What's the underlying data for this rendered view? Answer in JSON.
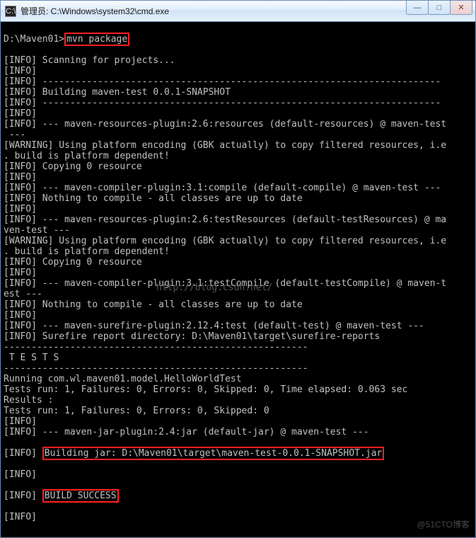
{
  "window": {
    "title": "管理员: C:\\Windows\\system32\\cmd.exe",
    "icon_label": "C:\\"
  },
  "controls": {
    "min": "—",
    "max": "□",
    "close": "✕"
  },
  "prompt": {
    "path": "D:\\Maven01>",
    "command": "mvn package"
  },
  "lines": [
    "[INFO] Scanning for projects...",
    "[INFO]",
    "[INFO] ------------------------------------------------------------------------",
    "[INFO] Building maven-test 0.0.1-SNAPSHOT",
    "[INFO] ------------------------------------------------------------------------",
    "[INFO]",
    "[INFO] --- maven-resources-plugin:2.6:resources (default-resources) @ maven-test",
    " ---",
    "[WARNING] Using platform encoding (GBK actually) to copy filtered resources, i.e",
    ". build is platform dependent!",
    "[INFO] Copying 0 resource",
    "[INFO]",
    "[INFO] --- maven-compiler-plugin:3.1:compile (default-compile) @ maven-test ---",
    "[INFO] Nothing to compile - all classes are up to date",
    "[INFO]",
    "[INFO] --- maven-resources-plugin:2.6:testResources (default-testResources) @ ma",
    "ven-test ---",
    "[WARNING] Using platform encoding (GBK actually) to copy filtered resources, i.e",
    ". build is platform dependent!",
    "[INFO] Copying 0 resource",
    "[INFO]",
    "[INFO] --- maven-compiler-plugin:3.1:testCompile (default-testCompile) @ maven-t",
    "est ---",
    "[INFO] Nothing to compile - all classes are up to date",
    "[INFO]",
    "[INFO] --- maven-surefire-plugin:2.12.4:test (default-test) @ maven-test ---",
    "[INFO] Surefire report directory: D:\\Maven01\\target\\surefire-reports",
    "",
    "-------------------------------------------------------",
    " T E S T S",
    "-------------------------------------------------------",
    "Running com.wl.maven01.model.HelloWorldTest",
    "Tests run: 1, Failures: 0, Errors: 0, Skipped: 0, Time elapsed: 0.063 sec",
    "",
    "Results :",
    "",
    "Tests run: 1, Failures: 0, Errors: 0, Skipped: 0",
    "",
    "[INFO]",
    "[INFO] --- maven-jar-plugin:2.4:jar (default-jar) @ maven-test ---"
  ],
  "hl_jar": {
    "prefix": "[INFO] ",
    "text": "Building jar: D:\\Maven01\\target\\maven-test-0.0.1-SNAPSHOT.jar"
  },
  "mid_info": "[INFO]",
  "hl_success": {
    "prefix": "[INFO] ",
    "text": "BUILD SUCCESS"
  },
  "last_info": "[INFO]",
  "watermark_faint": "http://blog.csdn.net/",
  "watermark": "@51CTO博客"
}
